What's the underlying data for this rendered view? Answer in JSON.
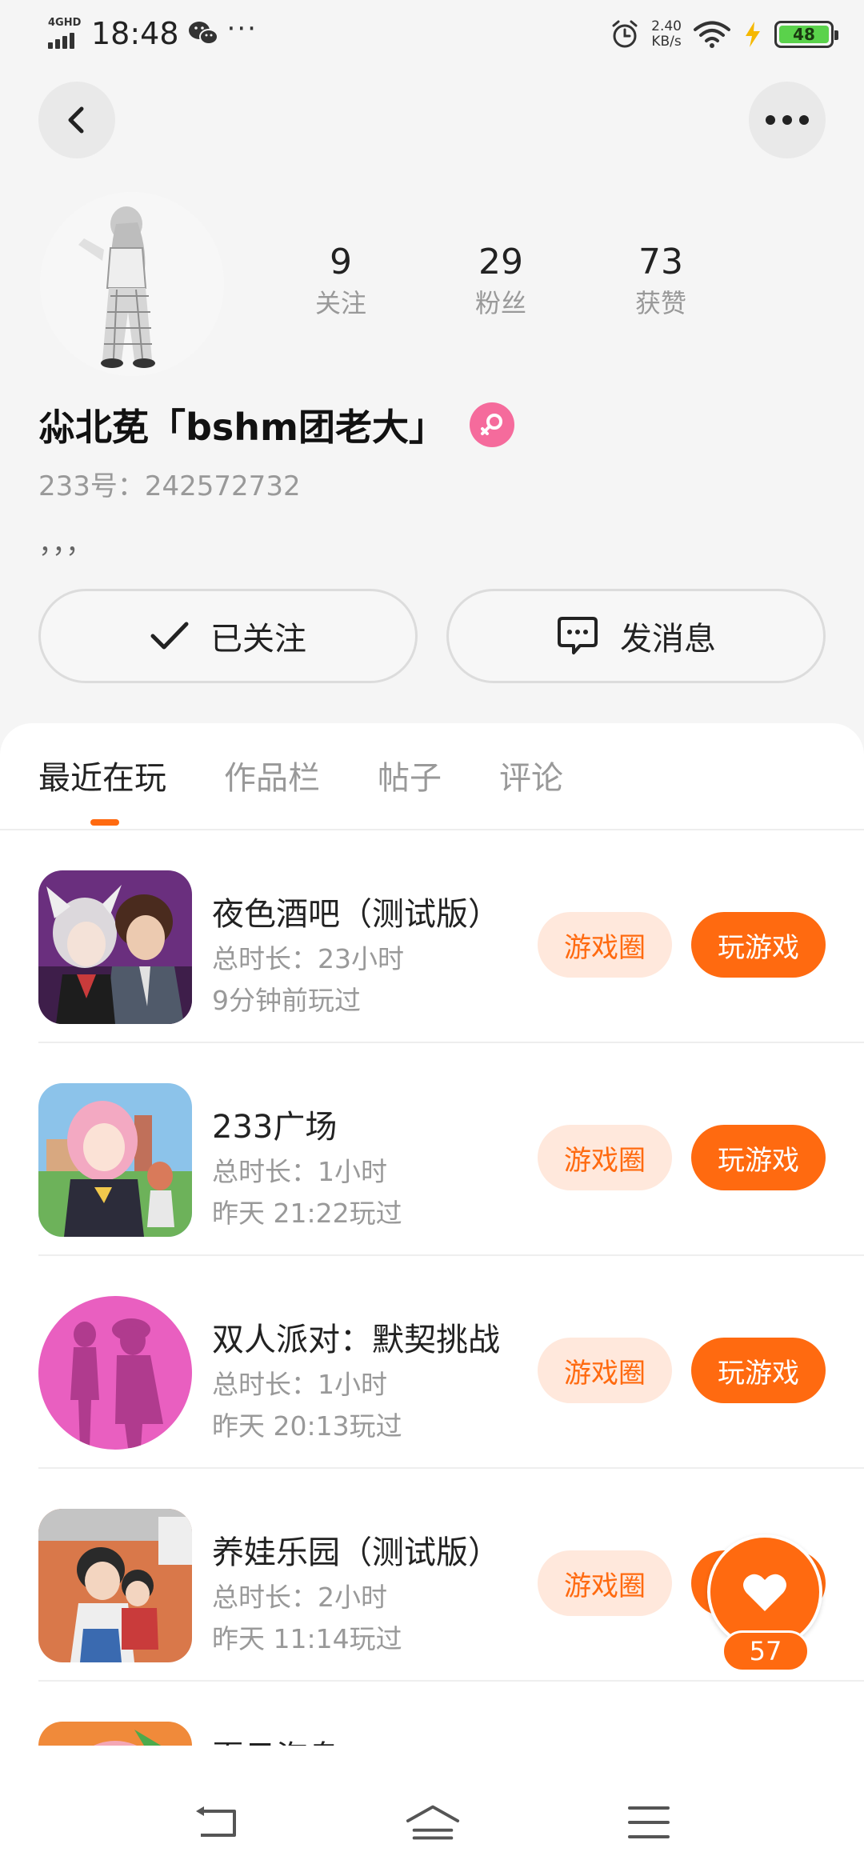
{
  "status_bar": {
    "network": "4GHD",
    "time": "18:48",
    "more": "···",
    "speed_value": "2.40",
    "speed_unit": "KB/s",
    "battery": "48"
  },
  "profile": {
    "stats": [
      {
        "value": "9",
        "label": "关注"
      },
      {
        "value": "29",
        "label": "粉丝"
      },
      {
        "value": "73",
        "label": "获赞"
      }
    ],
    "nickname": "尛北莬「bshm团老大」",
    "uid": "233号：242572732",
    "bio": "，，，",
    "follow_label": "已关注",
    "message_label": "发消息"
  },
  "tabs": [
    "最近在玩",
    "作品栏",
    "帖子",
    "评论"
  ],
  "games": [
    {
      "name": "夜色酒吧（测试版）",
      "duration": "总时长：23小时",
      "last_played": "9分钟前玩过",
      "circle_label": "游戏圈",
      "play_label": "玩游戏"
    },
    {
      "name": "233广场",
      "duration": "总时长：1小时",
      "last_played": "昨天 21:22玩过",
      "circle_label": "游戏圈",
      "play_label": "玩游戏"
    },
    {
      "name": "双人派对：默契挑战",
      "duration": "总时长：1小时",
      "last_played": "昨天 20:13玩过",
      "circle_label": "游戏圈",
      "play_label": "玩游戏"
    },
    {
      "name": "养娃乐园（测试版）",
      "duration": "总时长：2小时",
      "last_played": "昨天 11:14玩过",
      "circle_label": "游戏圈",
      "play_label": "玩游戏"
    },
    {
      "name": "夏日海岛",
      "duration": "",
      "last_played": "",
      "circle_label": "",
      "play_label": ""
    }
  ],
  "like": {
    "count": "57"
  },
  "colors": {
    "accent": "#ff6a10",
    "accent_light": "#ffe8dc",
    "gender": "#f56b9c",
    "muted": "#999999"
  },
  "icons": [
    "back-icon",
    "more-icon",
    "check-icon",
    "chat-icon",
    "female-icon",
    "heart-icon",
    "nav-back-icon",
    "nav-home-icon",
    "nav-menu-icon"
  ]
}
